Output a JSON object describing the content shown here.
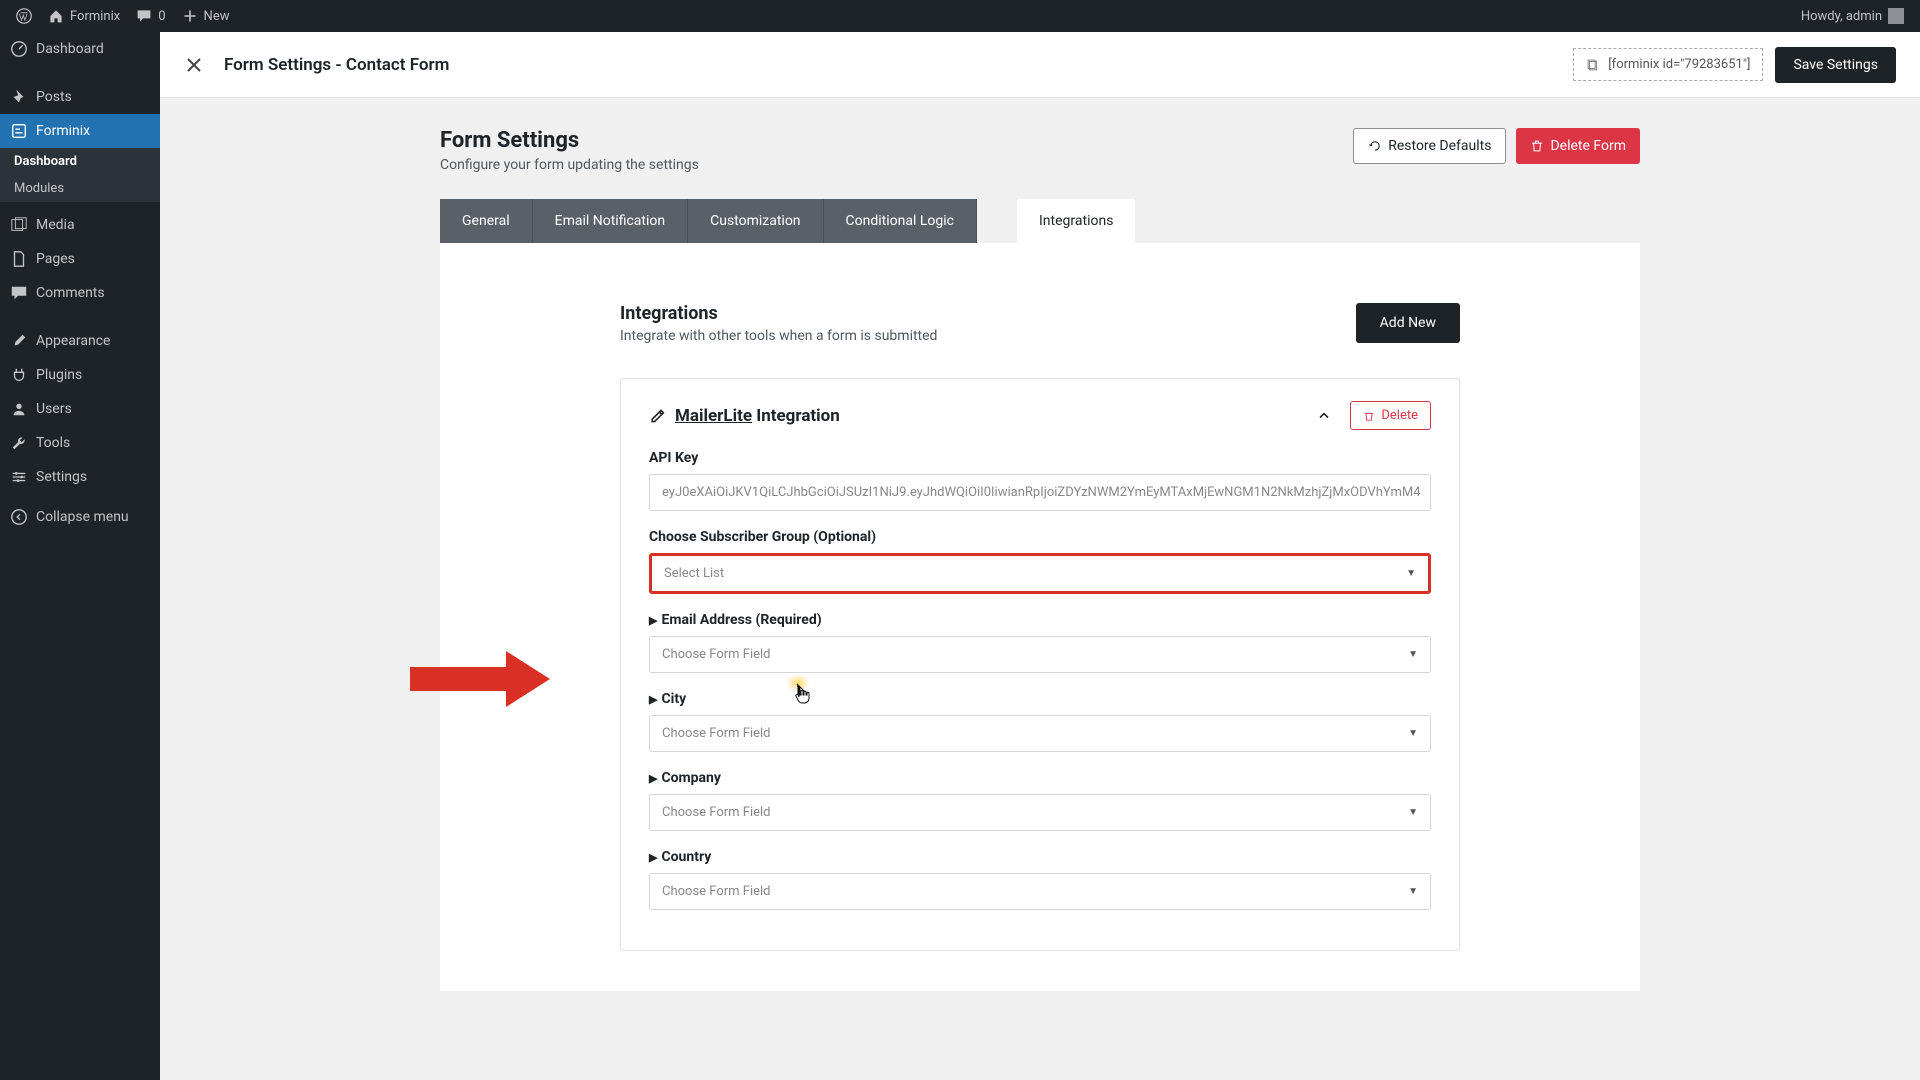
{
  "wpbar": {
    "site": "Forminix",
    "comments": "0",
    "new": "New",
    "howdy": "Howdy, admin"
  },
  "sidebar": {
    "items": [
      {
        "label": "Dashboard"
      },
      {
        "label": "Posts"
      },
      {
        "label": "Forminix"
      },
      {
        "label": "Media"
      },
      {
        "label": "Pages"
      },
      {
        "label": "Comments"
      },
      {
        "label": "Appearance"
      },
      {
        "label": "Plugins"
      },
      {
        "label": "Users"
      },
      {
        "label": "Tools"
      },
      {
        "label": "Settings"
      },
      {
        "label": "Collapse menu"
      }
    ],
    "sub": [
      {
        "label": "Dashboard"
      },
      {
        "label": "Modules"
      }
    ]
  },
  "topbar": {
    "title": "Form Settings - Contact Form",
    "shortcode": "[forminix id=\"79283651\"]",
    "save": "Save Settings"
  },
  "page": {
    "title": "Form Settings",
    "subtitle": "Configure your form updating the settings",
    "restore": "Restore Defaults",
    "delete": "Delete Form"
  },
  "tabs": [
    "General",
    "Email Notification",
    "Customization",
    "Conditional Logic",
    "Integrations"
  ],
  "section": {
    "title": "Integrations",
    "subtitle": "Integrate with other tools when a form is submitted",
    "add": "Add New"
  },
  "card": {
    "provider": "MailerLite",
    "suffix": " Integration",
    "delete": "Delete",
    "api_label": "API Key",
    "api_value": "eyJ0eXAiOiJKV1QiLCJhbGciOiJSUzI1NiJ9.eyJhdWQiOiI0IiwianRpIjoiZDYzNWM2YmEyMTAxMjEwNGM1N2NkMzhjZjMxODVhYmM4",
    "group_label": "Choose Subscriber Group (Optional)",
    "group_placeholder": "Select List",
    "fields": [
      {
        "label": "Email Address (Required)",
        "placeholder": "Choose Form Field"
      },
      {
        "label": "City",
        "placeholder": "Choose Form Field"
      },
      {
        "label": "Company",
        "placeholder": "Choose Form Field"
      },
      {
        "label": "Country",
        "placeholder": "Choose Form Field"
      }
    ]
  }
}
